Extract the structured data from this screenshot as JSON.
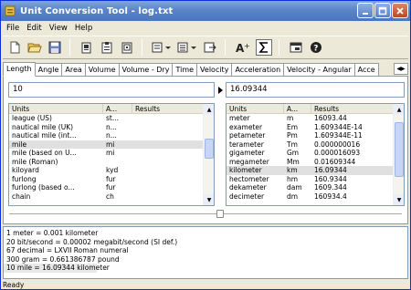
{
  "window": {
    "title": "Unit Conversion Tool - log.txt"
  },
  "menu": {
    "file": "File",
    "edit": "Edit",
    "view": "View",
    "help": "Help"
  },
  "tabs": [
    "Length",
    "Angle",
    "Area",
    "Volume",
    "Volume - Dry",
    "Time",
    "Velocity",
    "Acceleration",
    "Velocity - Angular",
    "Acce"
  ],
  "input": {
    "from_value": "10",
    "to_value": "16.09344"
  },
  "left_list": {
    "headers": {
      "units": "Units",
      "abbr": "A...",
      "results": "Results"
    },
    "rows": [
      {
        "units": "league (US)",
        "abbr": "st...",
        "results": ""
      },
      {
        "units": "nautical mile (UK)",
        "abbr": "n...",
        "results": ""
      },
      {
        "units": "nautical mile (int...",
        "abbr": "n...",
        "results": ""
      },
      {
        "units": "mile",
        "abbr": "mi",
        "results": ""
      },
      {
        "units": "mile (based on U...",
        "abbr": "mi",
        "results": ""
      },
      {
        "units": "mile (Roman)",
        "abbr": "",
        "results": ""
      },
      {
        "units": "kiloyard",
        "abbr": "kyd",
        "results": ""
      },
      {
        "units": "furlong",
        "abbr": "fur",
        "results": ""
      },
      {
        "units": "furlong (based o...",
        "abbr": "fur",
        "results": ""
      },
      {
        "units": "chain",
        "abbr": "ch",
        "results": ""
      }
    ]
  },
  "right_list": {
    "headers": {
      "units": "Units",
      "abbr": "A...",
      "results": "Results"
    },
    "rows": [
      {
        "units": "meter",
        "abbr": "m",
        "results": "16093.44"
      },
      {
        "units": "exameter",
        "abbr": "Em",
        "results": "1.609344E-14"
      },
      {
        "units": "petameter",
        "abbr": "Pm",
        "results": "1.609344E-11"
      },
      {
        "units": "terameter",
        "abbr": "Tm",
        "results": "0.000000016"
      },
      {
        "units": "gigameter",
        "abbr": "Gm",
        "results": "0.000016093"
      },
      {
        "units": "megameter",
        "abbr": "Mm",
        "results": "0.01609344"
      },
      {
        "units": "kilometer",
        "abbr": "km",
        "results": "16.09344"
      },
      {
        "units": "hectometer",
        "abbr": "hm",
        "results": "160.9344"
      },
      {
        "units": "dekameter",
        "abbr": "dam",
        "results": "1609.344"
      },
      {
        "units": "decimeter",
        "abbr": "dm",
        "results": "160934.4"
      }
    ]
  },
  "history": [
    "1 meter = 0.001 kilometer",
    "20 bit/second = 0.00002 megabit/second (SI def.)",
    "67 decimal = LXVII Roman numeral",
    "300 gram = 0.661386787 pound",
    "10 mile = 16.09344 kilometer"
  ],
  "status": "Ready",
  "icons": {
    "new": "new-file-icon",
    "open": "open-folder-icon",
    "save": "save-icon",
    "copy": "copy-icon",
    "sum": "sum-icon",
    "help": "help-icon"
  }
}
